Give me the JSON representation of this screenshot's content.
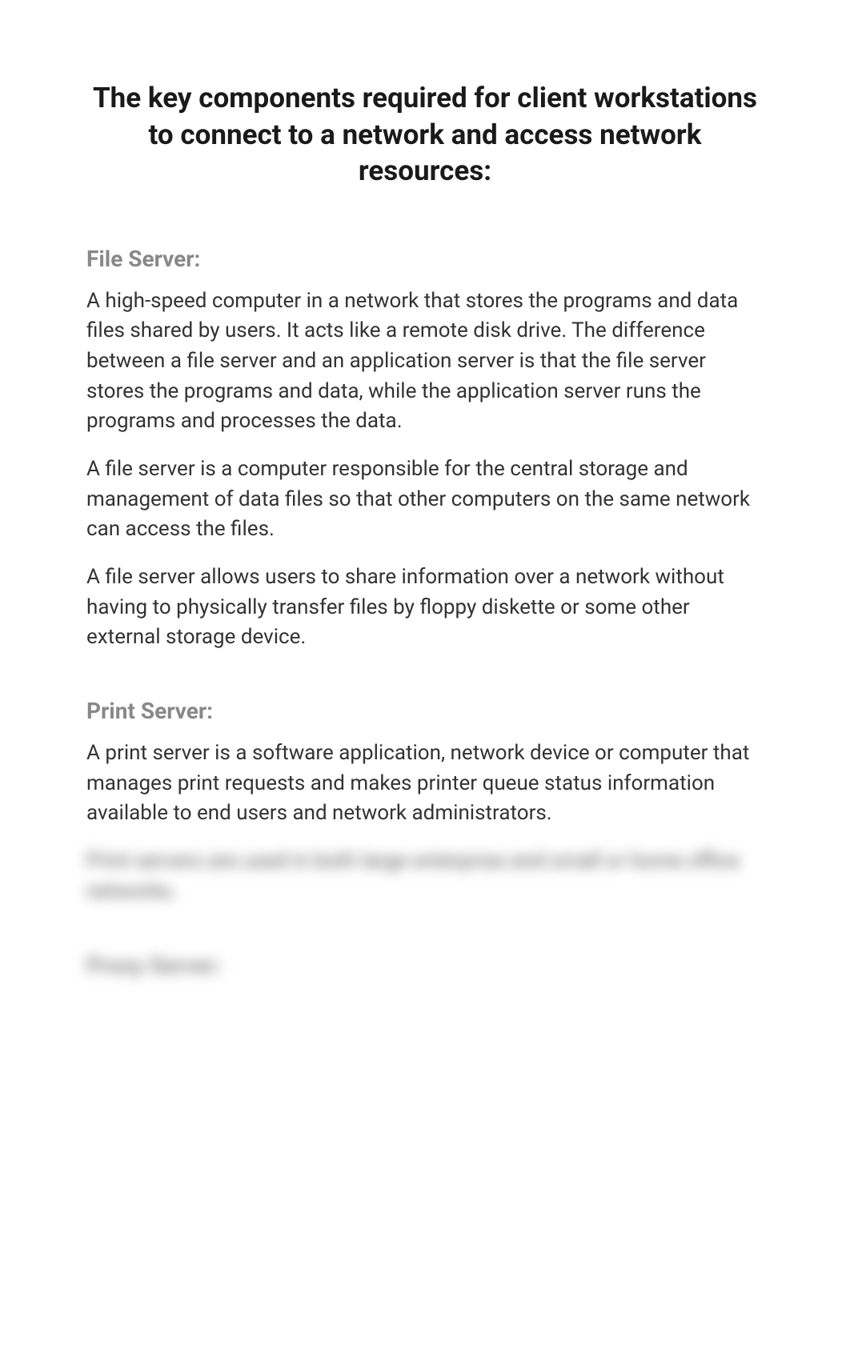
{
  "title": "The key components required for client workstations to connect to a network and access network resources:",
  "sections": [
    {
      "heading": "File Server:",
      "paragraphs": [
        "A high-speed computer in a network that stores the programs and data files shared by users. It acts like a remote disk drive. The difference between a file server and an application server is that the file server stores the programs and data, while the application server runs the programs and processes the data.",
        "A file server is a computer responsible for the central storage and management of data files so that other computers on the same network can access the files.",
        "A file server allows users to share information over a network without having to physically transfer files by floppy diskette or some other external storage device."
      ]
    },
    {
      "heading": "Print Server:",
      "paragraphs": [
        "A print server is a software application, network device or computer that manages print requests and makes printer queue status information available to end users and network administrators."
      ]
    }
  ],
  "blurred_paragraph": "Print servers are used in both large enterprise and small or home office networks.",
  "blurred_heading": "Proxy Server:"
}
